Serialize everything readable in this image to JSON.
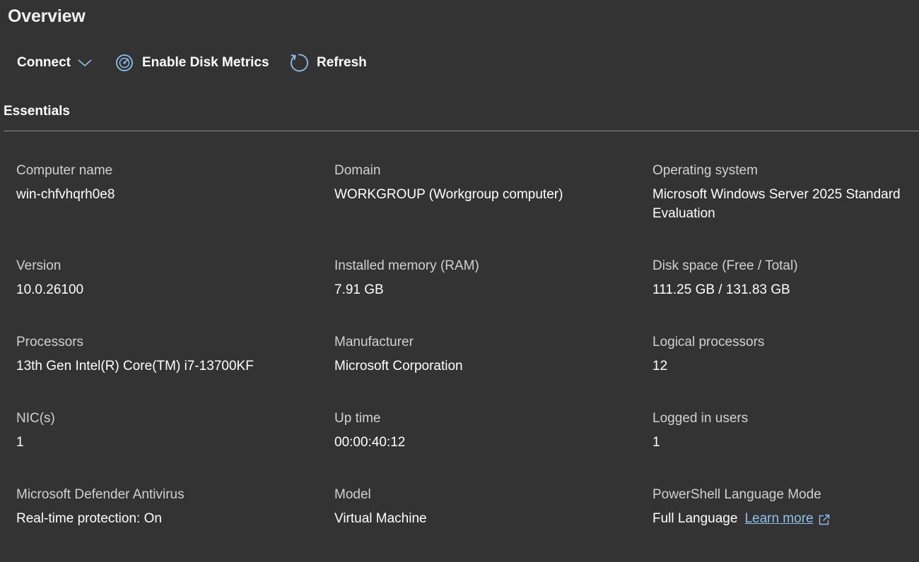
{
  "page": {
    "title": "Overview"
  },
  "toolbar": {
    "connect_label": "Connect",
    "enable_disk_metrics_label": "Enable Disk Metrics",
    "refresh_label": "Refresh",
    "icons": {
      "connect": "chevron-down-icon",
      "enable_disk_metrics": "speedometer-icon",
      "refresh": "refresh-icon"
    }
  },
  "essentials": {
    "title": "Essentials",
    "fields": {
      "computer_name": {
        "label": "Computer name",
        "value": "win-chfvhqrh0e8"
      },
      "domain": {
        "label": "Domain",
        "value": "WORKGROUP (Workgroup computer)"
      },
      "operating_system": {
        "label": "Operating system",
        "value": "Microsoft Windows Server 2025 Standard Evaluation"
      },
      "version": {
        "label": "Version",
        "value": "10.0.26100"
      },
      "installed_memory": {
        "label": "Installed memory (RAM)",
        "value": "7.91 GB"
      },
      "disk_space": {
        "label": "Disk space (Free / Total)",
        "value": "111.25 GB / 131.83 GB"
      },
      "processors": {
        "label": "Processors",
        "value": "13th Gen Intel(R) Core(TM) i7-13700KF"
      },
      "manufacturer": {
        "label": "Manufacturer",
        "value": "Microsoft Corporation"
      },
      "logical_processors": {
        "label": "Logical processors",
        "value": "12"
      },
      "nics": {
        "label": "NIC(s)",
        "value": "1"
      },
      "up_time": {
        "label": "Up time",
        "value": "00:00:40:12"
      },
      "logged_in_users": {
        "label": "Logged in users",
        "value": "1"
      },
      "defender": {
        "label": "Microsoft Defender Antivirus",
        "value": "Real-time protection: On"
      },
      "model": {
        "label": "Model",
        "value": "Virtual Machine"
      },
      "powershell_mode": {
        "label": "PowerShell Language Mode",
        "value": "Full Language",
        "link_label": "Learn more",
        "link_icon": "external-link-icon"
      }
    }
  },
  "colors": {
    "background": "#333333",
    "accent": "#8cc2f0",
    "label": "#d0d0d0",
    "divider": "#8a8a8a"
  }
}
